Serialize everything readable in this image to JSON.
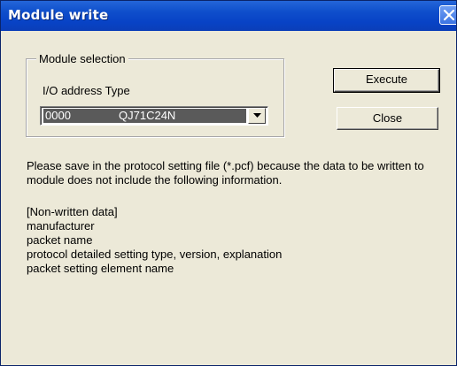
{
  "window": {
    "title": "Module write"
  },
  "module_selection": {
    "group_label": "Module selection",
    "io_label": "I/O address Type",
    "selected_io_address": "0000",
    "selected_type": "QJ71C24N"
  },
  "buttons": {
    "execute_label": "Execute",
    "close_label": "Close"
  },
  "message": {
    "text": "Please save in the protocol setting file (*.pcf) because the data to be written to module does not include the following information."
  },
  "non_written": {
    "heading": "[Non-written data]",
    "items": [
      "manufacturer",
      "packet name",
      "protocol detailed setting type, version, explanation",
      "packet setting element name"
    ]
  },
  "colors": {
    "titlebar": "#0843c6",
    "dialog_bg": "#ece9d8",
    "selection_bg": "#5a5a5a"
  },
  "icons": {
    "title_close": "close-icon",
    "dropdown": "chevron-down-icon"
  }
}
